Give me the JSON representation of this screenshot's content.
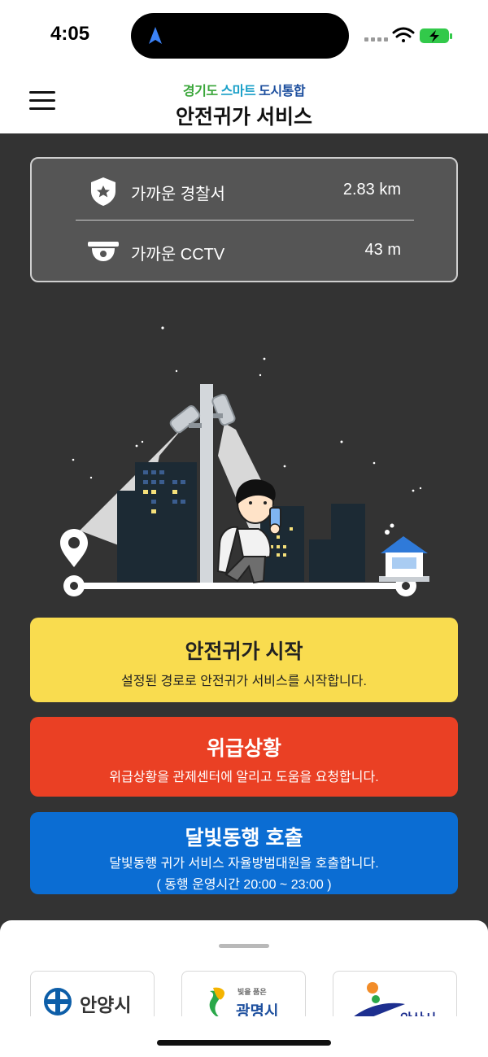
{
  "status_bar": {
    "time": "4:05"
  },
  "header": {
    "brand_sub_part1": "경기도",
    "brand_sub_part2": "스마트",
    "brand_sub_part3": "도시통합",
    "title": "안전귀가 서비스"
  },
  "info": {
    "rows": [
      {
        "label": "가까운 경찰서",
        "value": "2.83 km",
        "icon": "police-badge-icon"
      },
      {
        "label": "가까운 CCTV",
        "value": "43 m",
        "icon": "cctv-icon"
      }
    ]
  },
  "buttons": {
    "start": {
      "title": "안전귀가 시작",
      "desc": "설정된 경로로 안전귀가 서비스를 시작합니다."
    },
    "emergency": {
      "title": "위급상황",
      "desc": "위급상황을 관제센터에 알리고 도움을 요청합니다."
    },
    "moonlight": {
      "title": "달빛동행 호출",
      "desc": "달빛동행 귀가 서비스 자율방범대원을 호출합니다.",
      "desc2": "( 동행 운영시간 20:00 ~ 23:00 )"
    }
  },
  "sheet": {
    "logos": [
      {
        "name": "안양시"
      },
      {
        "name": "광명시",
        "tagline": "빛을 품은"
      },
      {
        "name": "안산시"
      }
    ]
  },
  "colors": {
    "background": "#333333",
    "start": "#f9dc4f",
    "emergency": "#ea4024",
    "moonlight": "#0b6dd3"
  }
}
